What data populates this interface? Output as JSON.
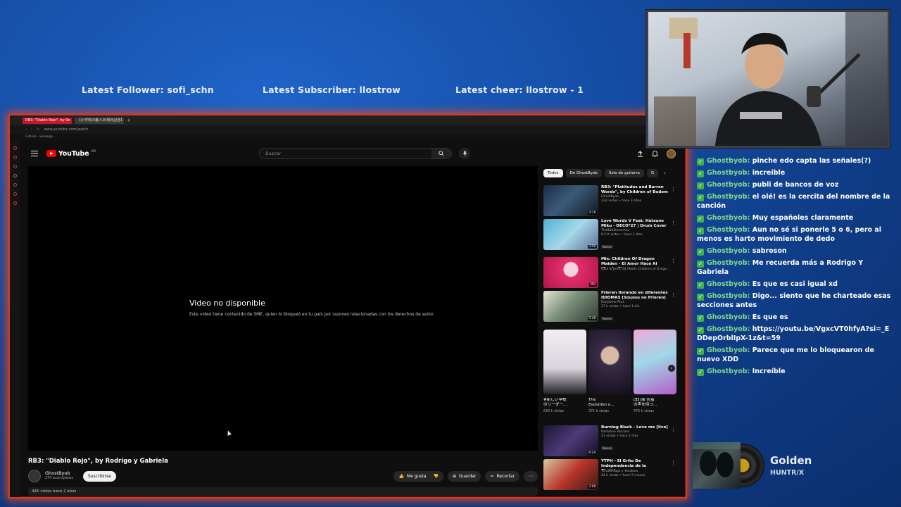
{
  "overlay": {
    "latest_follower": "Latest Follower: sofi_schn",
    "latest_subscriber": "Latest Subscriber: llostrow",
    "latest_cheer": "Latest cheer: llostrow - 1"
  },
  "browser": {
    "tabs": [
      {
        "label": "RB3: \"Diablo Rojo\", by Ro",
        "active": true
      },
      {
        "label": "【小学校の義人20周年記念】(",
        "active": false
      }
    ],
    "url": "www.youtube.com/watch",
    "bookmark": "GitHub - windopp..."
  },
  "youtube": {
    "logo_text": "YouTube",
    "region": "MX",
    "search_placeholder": "Buscar",
    "player": {
      "unavailable_title": "Video no disponible",
      "unavailable_message": "Este video tiene contenido de SME, quien lo bloqueó en tu país por razones relacionadas con los derechos de autor."
    },
    "video_title": "RB3: \"Diablo Rojo\", by Rodrigo y Gabriela",
    "channel": {
      "name": "GhostByob",
      "subscribers": "274 suscriptores",
      "subscribe_label": "Suscribirse"
    },
    "actions": {
      "like": "Me gusta",
      "save": "Guardar",
      "clip": "Recortar"
    },
    "meta_strip": "445 vistas  hace 2 años",
    "chips": [
      "Todos",
      "De GhostByob",
      "Solo de guitarra",
      "G"
    ],
    "recommendations": [
      {
        "title": "RB3: \"Platitudes and Barren Words\", by Children of Bodom",
        "channel": "GhostByob",
        "meta": "233 vistas • hace 3 años",
        "duration": "4:16",
        "badge": "",
        "color": "#2a3b55"
      },
      {
        "title": "Love Words V Feat. Hatsune Miku - DECO*27 | Drum Cover",
        "channel": "The8bitDrummer",
        "meta": "8.2 K vistas • hace 2 días",
        "duration": "3:50",
        "badge": "Nuevo",
        "color": "#3d8fb8"
      },
      {
        "title": "Mix: Children Of Dragon Maiden - El Amor Hace Al Mundo Girar...",
        "channel": "Ollie & Jerry, DJ Abdel, Children of Drago...",
        "meta": "",
        "duration": "Mix",
        "badge": "",
        "color": "#d3205a"
      },
      {
        "title": "Frieren llorando en diferentes IDIOMAS [Sousou no Frieren]",
        "channel": "Randome Plus",
        "meta": "27 k vistas • hace 1 día",
        "duration": "5:46",
        "badge": "Nuevo",
        "color": "#6a7f6a"
      },
      {
        "title": "Burning Black - Love me [live]",
        "channel": "Damiano Vaccaro",
        "meta": "21 vistas • hace 2 días",
        "duration": "6:24",
        "badge": "Nuevo",
        "color": "#3a2f5a"
      },
      {
        "title": "YTPH - El Grito De Independencia de la Sheinbau...",
        "channel": "YeraldPoops y Yeraldos",
        "meta": "24 k vistas • hace 5 meses",
        "duration": "2:09",
        "badge": "",
        "color": "#a83226"
      }
    ],
    "shorts": [
      {
        "title": "#新しい学校\nのリーダー...",
        "views": "630 k vistas",
        "color": "#e7e5ea"
      },
      {
        "title": "The\nEvolution o...",
        "views": "371 k vistas",
        "color": "#2b2336"
      },
      {
        "title": "改訂版 死者\nの声を持つ...",
        "views": "475 k vistas",
        "color": "#b878d6"
      }
    ]
  },
  "chat": [
    {
      "user": "Ghostbyob:",
      "text": "pinche edo capta las señales(?)"
    },
    {
      "user": "Ghostbyob:",
      "text": "increible"
    },
    {
      "user": "Ghostbyob:",
      "text": "publi de bancos de voz"
    },
    {
      "user": "Ghostbyob:",
      "text": "el olé! es la cercita del nombre de la canción"
    },
    {
      "user": "Ghostbyob:",
      "text": "Muy españoles claramente"
    },
    {
      "user": "Ghostbyob:",
      "text": "Aun no sé si ponerle 5 o 6, pero al menos es harto movimiento de dedo"
    },
    {
      "user": "Ghostbyob:",
      "text": "sabroson"
    },
    {
      "user": "Ghostbyob:",
      "text": "Me recuerda más a Rodrigo Y Gabriela"
    },
    {
      "user": "Ghostbyob:",
      "text": "Es que es casi igual xd"
    },
    {
      "user": "Ghostbyob:",
      "text": "Digo... siento que he charteado esas secciones antes"
    },
    {
      "user": "Ghostbyob:",
      "text": "Es que es"
    },
    {
      "user": "Ghostbyob:",
      "text": "https://youtu.be/VgxcVT0hfyA?si=_EDDepOrblIpX-1z&t=59"
    },
    {
      "user": "Ghostbyob:",
      "text": "Parece que me lo bloquearon de nuevo XDD"
    },
    {
      "user": "Ghostbyob:",
      "text": "Increíble"
    }
  ],
  "now_playing": {
    "song": "Golden",
    "artist": "HUNTR/X"
  }
}
